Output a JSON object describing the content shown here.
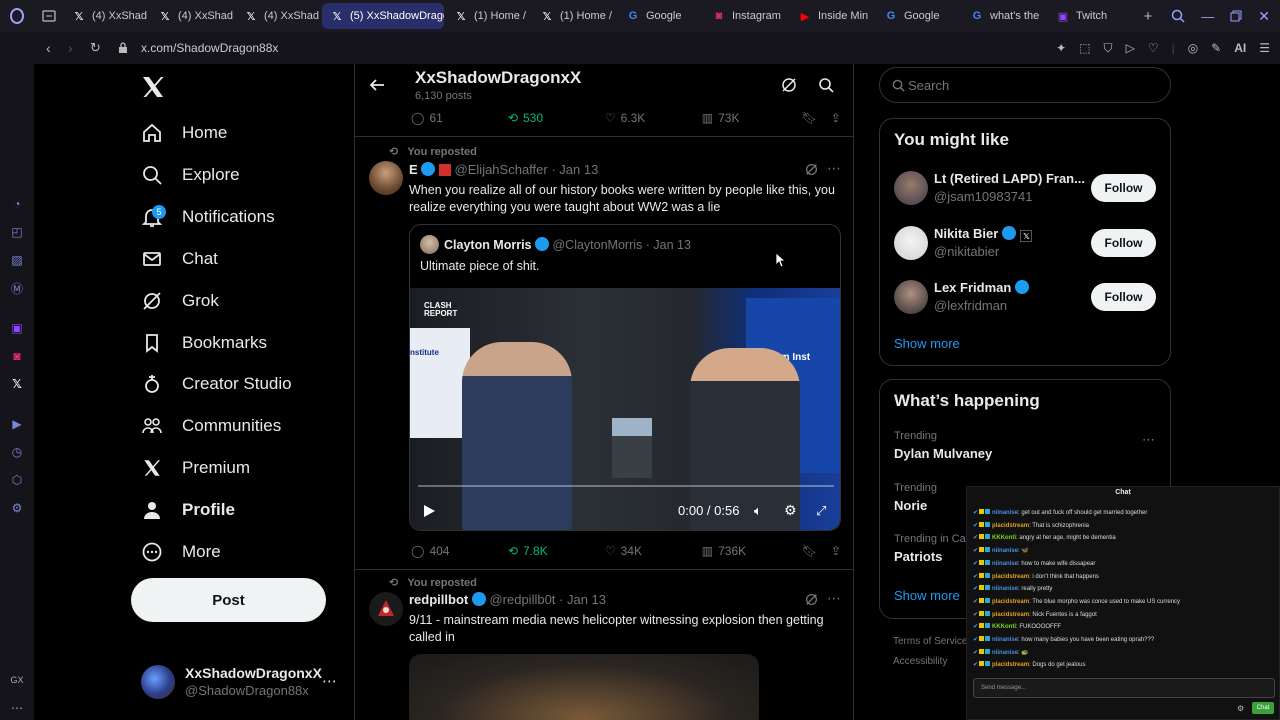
{
  "browser": {
    "tabs": [
      {
        "label": "(4) XxShad",
        "icon": "x"
      },
      {
        "label": "(4) XxShad",
        "icon": "x"
      },
      {
        "label": "(4) XxShad",
        "icon": "x"
      },
      {
        "label": "(5) XxShadowDrago",
        "icon": "x",
        "active": true
      },
      {
        "label": "(1) Home /",
        "icon": "x"
      },
      {
        "label": "(1) Home /",
        "icon": "x"
      },
      {
        "label": "Google",
        "icon": "google"
      },
      {
        "label": "Instagram",
        "icon": "instagram"
      },
      {
        "label": "Inside Min",
        "icon": "youtube"
      },
      {
        "label": "Google",
        "icon": "google"
      },
      {
        "label": "what's the",
        "icon": "google"
      },
      {
        "label": "Twitch",
        "icon": "twitch"
      }
    ],
    "url": "x.com/ShadowDragon88x",
    "ai_label": "AI",
    "colors": {
      "accent": "#1d9bf0",
      "repost": "#00ba7c",
      "twitch": "#9146ff"
    }
  },
  "nav": {
    "items": [
      {
        "label": "Home",
        "icon": "home-icon"
      },
      {
        "label": "Explore",
        "icon": "search-icon"
      },
      {
        "label": "Notifications",
        "icon": "bell-icon",
        "badge": "5"
      },
      {
        "label": "Chat",
        "icon": "mail-icon"
      },
      {
        "label": "Grok",
        "icon": "grok-icon"
      },
      {
        "label": "Bookmarks",
        "icon": "bookmark-icon"
      },
      {
        "label": "Creator Studio",
        "icon": "creator-icon"
      },
      {
        "label": "Communities",
        "icon": "communities-icon"
      },
      {
        "label": "Premium",
        "icon": "x-logo-icon"
      },
      {
        "label": "Profile",
        "icon": "person-icon",
        "bold": true
      },
      {
        "label": "More",
        "icon": "more-icon"
      }
    ],
    "post_label": "Post",
    "account": {
      "name": "XxShadowDragonxX",
      "handle": "@ShadowDragon88x"
    }
  },
  "header": {
    "name": "XxShadowDragonxX",
    "posts": "6,130 posts"
  },
  "top_actions": {
    "replies": "61",
    "reposts": "530",
    "likes": "6.3K",
    "views": "73K"
  },
  "tweets": [
    {
      "reposted_label": "You reposted",
      "name": "E",
      "handle": "@ElijahSchaffer",
      "date": "· Jan 13",
      "text": "When you realize all of our history books were written by people like this, you realize everything you were taught about WW2 was a lie",
      "quote": {
        "name": "Clayton Morris",
        "handle": "@ClaytonMorris",
        "date": "· Jan 13",
        "text": "Ultimate piece of shit.",
        "video_time": "0:00 / 0:56",
        "video_texts": [
          "CLASH REPORT",
          "nstitute",
          "MirYam Inst"
        ]
      },
      "actions": {
        "replies": "404",
        "reposts": "7.8K",
        "likes": "34K",
        "views": "736K"
      }
    },
    {
      "reposted_label": "You reposted",
      "name": "redpillbot",
      "handle": "@redpillb0t",
      "date": "· Jan 13",
      "text": "9/11 - mainstream media news helicopter witnessing explosion then getting called in"
    }
  ],
  "right": {
    "search_placeholder": "Search",
    "might_like": {
      "title": "You might like",
      "users": [
        {
          "name": "Lt (Retired LAPD) Fran...",
          "handle": "@jsam10983741",
          "follow": "Follow"
        },
        {
          "name": "Nikita Bier",
          "handle": "@nikitabier",
          "follow": "Follow"
        },
        {
          "name": "Lex Fridman",
          "handle": "@lexfridman",
          "follow": "Follow"
        }
      ],
      "show_more": "Show more"
    },
    "happening": {
      "title": "What’s happening",
      "trends": [
        {
          "context": "Trending",
          "name": "Dylan Mulvaney"
        },
        {
          "context": "Trending",
          "name": "Norie"
        },
        {
          "context": "Trending in Ca",
          "name": "Patriots"
        }
      ],
      "show_more": "Show more"
    },
    "footer": [
      "Terms of Service",
      "Accessibility"
    ]
  },
  "chat": {
    "title": "Chat",
    "messages": [
      {
        "user": "niinanise",
        "text": "get out and fuck off should get married together",
        "color": "#4a90e2"
      },
      {
        "user": "placidstream",
        "text": "That is schizophrenia",
        "color": "#e0a020"
      },
      {
        "user": "KKKonti",
        "text": "angry at her age, might be dementia",
        "color": "#7ed321"
      },
      {
        "user": "niinanise",
        "text": "🦋",
        "color": "#4a90e2"
      },
      {
        "user": "niinanise",
        "text": "how to make wife dissapear",
        "color": "#4a90e2"
      },
      {
        "user": "placidstream",
        "text": "i don't think that happens",
        "color": "#e0a020"
      },
      {
        "user": "niinanise",
        "text": "really pretty",
        "color": "#4a90e2"
      },
      {
        "user": "placidstream",
        "text": "The blue morpho was conce used to make US currency",
        "color": "#e0a020"
      },
      {
        "user": "placidstream",
        "text": "Nick Fuentes is a faggot",
        "color": "#e0a020"
      },
      {
        "user": "KKKonti",
        "text": "FUKOOOOFFF",
        "color": "#7ed321"
      },
      {
        "user": "niinanise",
        "text": "how many babies you have been eating oprah???",
        "color": "#4a90e2"
      },
      {
        "user": "niinanise",
        "text": "🐢",
        "color": "#4a90e2"
      },
      {
        "user": "placidstream",
        "text": "Dogs do get jealous",
        "color": "#e0a020"
      }
    ],
    "input_placeholder": "Send message...",
    "send_label": "Chat"
  }
}
